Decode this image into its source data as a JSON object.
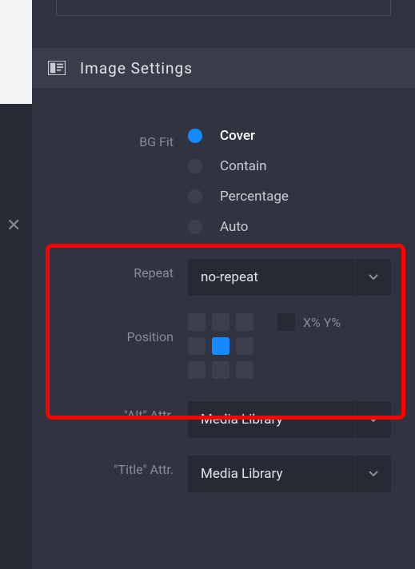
{
  "sectionTitle": "Image  Settings",
  "bgFit": {
    "label": "BG Fit",
    "options": [
      "Cover",
      "Contain",
      "Percentage",
      "Auto"
    ],
    "selected": "Cover"
  },
  "repeat": {
    "label": "Repeat",
    "value": "no-repeat"
  },
  "position": {
    "label": "Position",
    "selectedCell": 4,
    "xyLabel": "X% Y%"
  },
  "altAttr": {
    "label": "\"Alt\" Attr.",
    "value": "Media Library"
  },
  "titleAttr": {
    "label": "\"Title\" Attr.",
    "value": "Media Library"
  }
}
